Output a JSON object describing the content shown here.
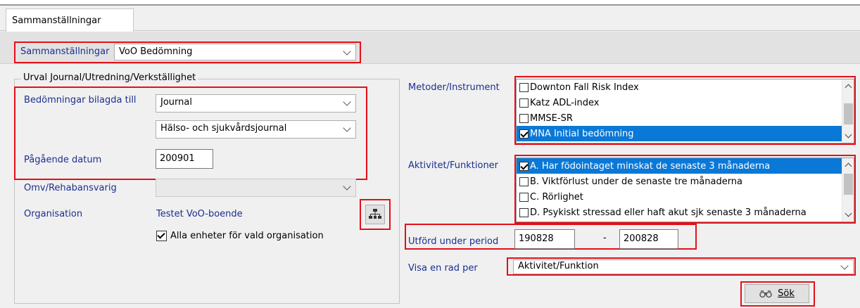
{
  "tab": {
    "label": "Sammanställningar"
  },
  "toolbar": {
    "label": "Sammanställningar",
    "value": "VoO Bedömning"
  },
  "selection": {
    "group_title": "Urval Journal/Utredning/Verkställighet",
    "assessments_label": "Bedömningar bilagda till",
    "assessments_value": "Journal",
    "journal_type_value": "Hälso- och sjukvårdsjournal",
    "ongoing_date_label": "Pågående datum",
    "ongoing_date_value": "200901",
    "responsible_label": "Omv/Rehabansvarig",
    "responsible_value": "",
    "organisation_label": "Organisation",
    "organisation_value": "Testet VoO-boende",
    "all_units_label": "Alla enheter för vald organisation",
    "all_units_checked": true,
    "org_tree_icon": "org-tree-icon"
  },
  "methods": {
    "label": "Metoder/Instrument",
    "items": [
      {
        "label": "Downton Fall Risk Index",
        "checked": false,
        "selected": false
      },
      {
        "label": "Katz ADL-index",
        "checked": false,
        "selected": false
      },
      {
        "label": "MMSE-SR",
        "checked": false,
        "selected": false
      },
      {
        "label": "MNA Initial bedömning",
        "checked": true,
        "selected": true
      }
    ]
  },
  "activities": {
    "label": "Aktivitet/Funktioner",
    "items": [
      {
        "label": "A. Har födointaget minskat de senaste 3 månaderna",
        "checked": true,
        "selected": true
      },
      {
        "label": "B. Viktförlust under de senaste tre månaderna",
        "checked": false,
        "selected": false
      },
      {
        "label": "C. Rörlighet",
        "checked": false,
        "selected": false
      },
      {
        "label": "D. Psykiskt stressad eller haft akut sjk senaste 3 månaderna",
        "checked": false,
        "selected": false
      }
    ]
  },
  "period": {
    "label": "Utförd under period",
    "from": "190828",
    "separator": "-",
    "to": "200828"
  },
  "row_per": {
    "label": "Visa en rad per",
    "value": "Aktivitet/Funktion"
  },
  "search": {
    "label": "Sök",
    "icon": "binoculars-icon"
  },
  "colors": {
    "highlight": "#e3101a",
    "selection": "#0a78d7",
    "label_blue": "#1b2f8f"
  }
}
